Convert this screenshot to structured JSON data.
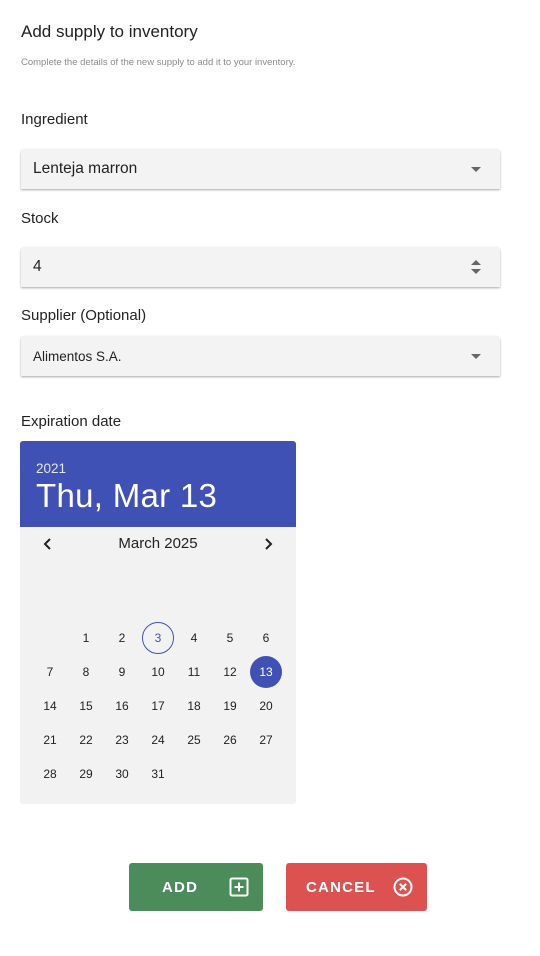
{
  "header": {
    "title": "Add supply to inventory",
    "subtitle": "Complete the details of the new supply to add it to your inventory."
  },
  "fields": {
    "ingredient": {
      "label": "Ingredient",
      "value": "Lenteja marron"
    },
    "stock": {
      "label": "Stock",
      "value": "4"
    },
    "supplier": {
      "label": "Supplier (Optional)",
      "value": "Alimentos S.A."
    },
    "expiration": {
      "label": "Expiration date"
    }
  },
  "datepicker": {
    "year": "2021",
    "selected_label": "Thu, Mar 13",
    "month_label": "March 2025",
    "today_day": 3,
    "selected_day": 13,
    "weeks": [
      [
        "",
        "1",
        "2",
        "3",
        "4",
        "5",
        "6"
      ],
      [
        "7",
        "8",
        "9",
        "10",
        "11",
        "12",
        "13"
      ],
      [
        "14",
        "15",
        "16",
        "17",
        "18",
        "19",
        "20"
      ],
      [
        "21",
        "22",
        "23",
        "24",
        "25",
        "26",
        "27"
      ],
      [
        "28",
        "29",
        "30",
        "31",
        "",
        "",
        ""
      ]
    ],
    "accent_color": "#3f51b5"
  },
  "actions": {
    "add_label": "ADD",
    "cancel_label": "CANCEL",
    "add_color": "#4c8c5a",
    "cancel_color": "#dc5251"
  }
}
